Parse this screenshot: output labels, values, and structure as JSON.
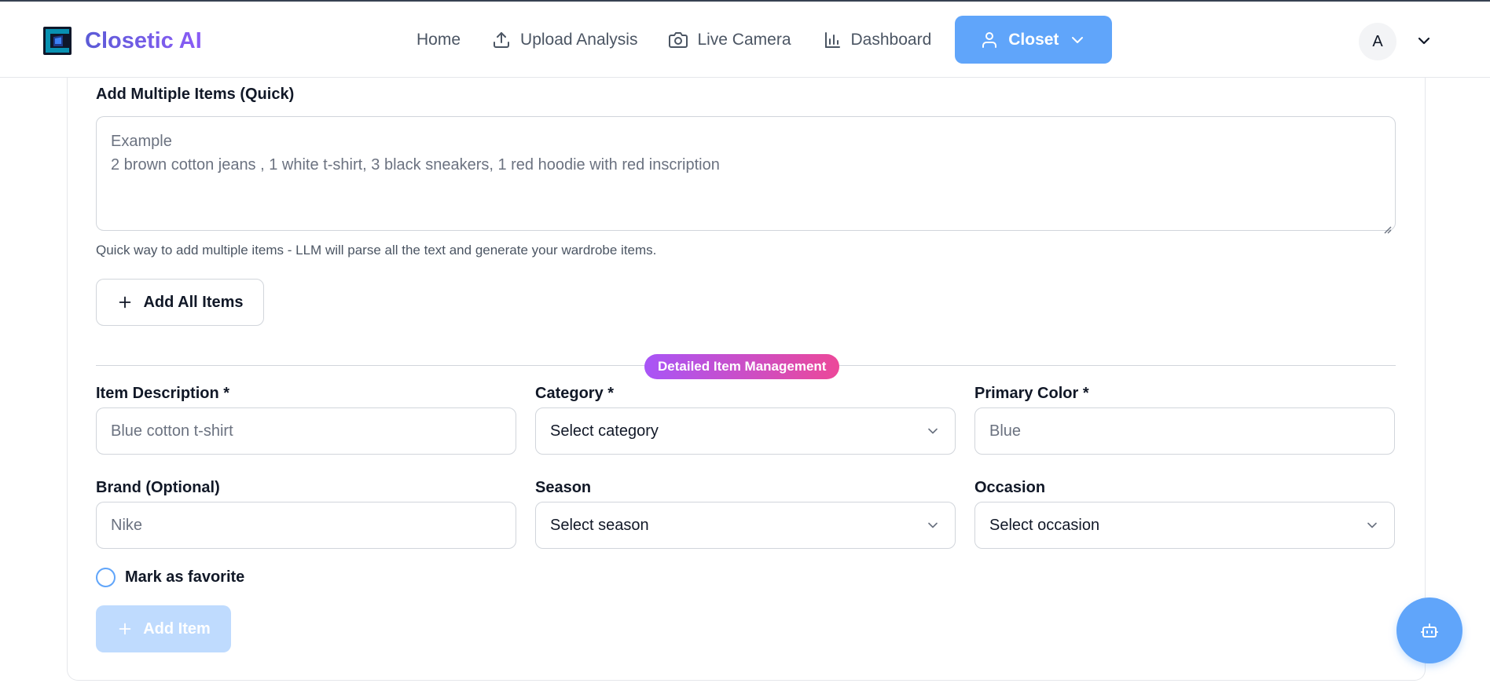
{
  "app": {
    "name": "Closetic AI",
    "logo_icon": "closetic-logo-icon",
    "accent_color": "#60a5fa",
    "brand_gradient": [
      "#5b5bd6",
      "#8b5cf6"
    ]
  },
  "nav": {
    "items": [
      {
        "label": "Home",
        "icon": null,
        "active": false
      },
      {
        "label": "Upload Analysis",
        "icon": "upload-icon",
        "active": false
      },
      {
        "label": "Live Camera",
        "icon": "camera-icon",
        "active": false
      },
      {
        "label": "Dashboard",
        "icon": "bar-chart-icon",
        "active": false
      },
      {
        "label": "Closet",
        "icon": "user-icon",
        "active": true,
        "has_dropdown": true
      }
    ]
  },
  "user": {
    "avatar_initial": "A"
  },
  "quick_add": {
    "label": "Add Multiple Items (Quick)",
    "placeholder_line1": "Example",
    "placeholder_line2": "2 brown cotton jeans , 1 white t-shirt, 3 black sneakers, 1 red hoodie with red inscription",
    "helper": "Quick way to add multiple items - LLM will parse all the text and generate your wardrobe items.",
    "button_label": "Add All Items"
  },
  "section_badge": {
    "label": "Detailed Item Management",
    "gradient": [
      "#a855f7",
      "#ec4899"
    ]
  },
  "form": {
    "description": {
      "label": "Item Description *",
      "placeholder": "Blue cotton t-shirt"
    },
    "category": {
      "label": "Category *",
      "value": "Select category"
    },
    "primary_color": {
      "label": "Primary Color *",
      "placeholder": "Blue"
    },
    "brand": {
      "label": "Brand (Optional)",
      "placeholder": "Nike"
    },
    "season": {
      "label": "Season",
      "value": "Select season"
    },
    "occasion": {
      "label": "Occasion",
      "value": "Select occasion"
    },
    "favorite": {
      "label": "Mark as favorite",
      "checked": false
    },
    "submit_label": "Add Item"
  },
  "assistant": {
    "icon": "bot-icon"
  }
}
